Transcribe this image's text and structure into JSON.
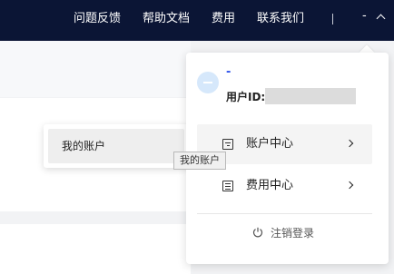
{
  "topbar": {
    "nav": [
      "问题反馈",
      "帮助文档",
      "费用",
      "联系我们"
    ],
    "user_label": "-"
  },
  "submenu": {
    "item_label": "我的账户"
  },
  "tooltip": {
    "text": "我的账户"
  },
  "dropdown": {
    "avatar_text": "-",
    "user_name": "-",
    "uid_label": "用户ID:",
    "uid_value": "",
    "items": [
      {
        "label": "账户中心",
        "icon": "account-center-icon"
      },
      {
        "label": "费用中心",
        "icon": "billing-center-icon"
      }
    ],
    "logout_label": "注销登录"
  },
  "colors": {
    "topbar_bg": "#0b1535",
    "accent": "#2f54eb",
    "avatar_bg": "#d6e8fb"
  }
}
